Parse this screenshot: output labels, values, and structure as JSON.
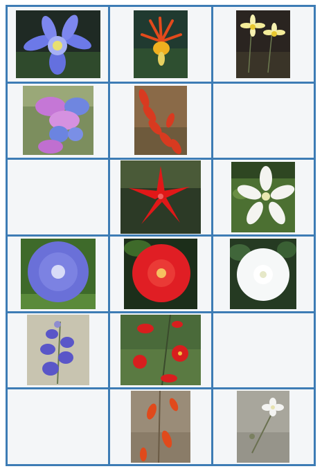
{
  "grid": {
    "rows": 6,
    "cols": 3,
    "border_color": "#3d7cb5",
    "cell_background": "#f4f6f8"
  },
  "cells": [
    {
      "row": 1,
      "col": 1,
      "photo": "blue-columbine-flower-icon"
    },
    {
      "row": 1,
      "col": 2,
      "photo": "red-columbine-flower-icon"
    },
    {
      "row": 1,
      "col": 3,
      "photo": "yellow-columbine-flower-icon"
    },
    {
      "row": 2,
      "col": 1,
      "photo": "blue-penstemon-flower-icon"
    },
    {
      "row": 2,
      "col": 2,
      "photo": "red-penstemon-flower-icon"
    },
    {
      "row": 2,
      "col": 3,
      "photo": null
    },
    {
      "row": 3,
      "col": 1,
      "photo": null
    },
    {
      "row": 3,
      "col": 2,
      "photo": "red-star-flower-icon"
    },
    {
      "row": 3,
      "col": 3,
      "photo": "white-star-flower-icon"
    },
    {
      "row": 4,
      "col": 1,
      "photo": "blue-morning-glory-icon"
    },
    {
      "row": 4,
      "col": 2,
      "photo": "red-morning-glory-icon"
    },
    {
      "row": 4,
      "col": 3,
      "photo": "white-morning-glory-icon"
    },
    {
      "row": 5,
      "col": 1,
      "photo": "blue-larkspur-icon"
    },
    {
      "row": 5,
      "col": 2,
      "photo": "red-trumpet-flower-icon"
    },
    {
      "row": 5,
      "col": 3,
      "photo": null
    },
    {
      "row": 6,
      "col": 1,
      "photo": null
    },
    {
      "row": 6,
      "col": 2,
      "photo": "orange-tubular-flower-icon"
    },
    {
      "row": 6,
      "col": 3,
      "photo": "white-small-flower-icon"
    }
  ]
}
